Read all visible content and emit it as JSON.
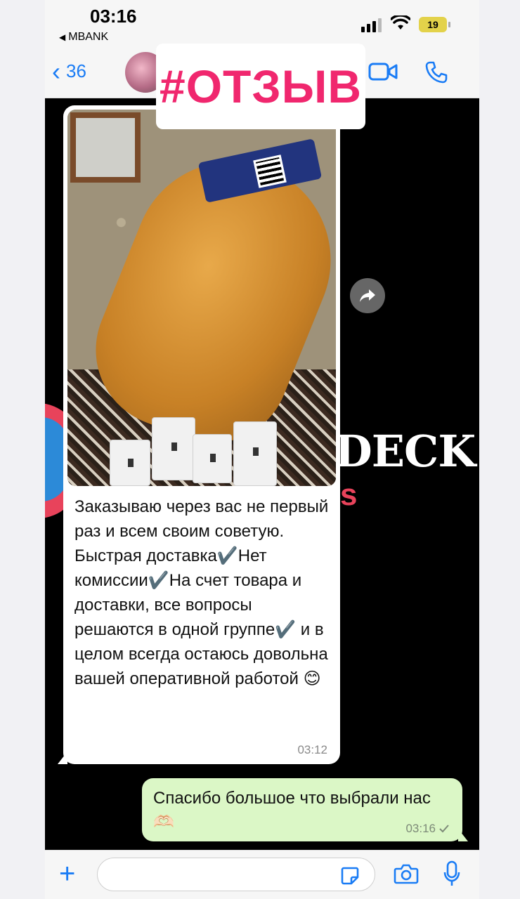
{
  "status_bar": {
    "time": "03:16",
    "carrier": "MBANK",
    "battery": "19"
  },
  "header": {
    "back_count": "36",
    "contact_avatar": "avatar",
    "icons": [
      "back-chevron-icon",
      "video-call-icon",
      "phone-call-icon"
    ]
  },
  "sticker": {
    "text": "#ОТЗЫВ"
  },
  "background_brand": {
    "deck": "DECK",
    "s": "s"
  },
  "messages": [
    {
      "direction": "incoming",
      "has_photo": true,
      "text": "Заказываю через вас не первый раз и всем своим советую. Быстрая доставка✔️Нет комиссии✔️На счет товара и доставки, все вопросы решаются в одной группе✔️ и в целом всегда остаюсь довольна вашей оперативной работой 😊",
      "time": "03:12"
    },
    {
      "direction": "outgoing",
      "text": "Спасибо большое  что выбрали нас 🫶🏻",
      "time": "03:16"
    }
  ],
  "input_bar": {
    "placeholder": "",
    "icons": [
      "plus-icon",
      "sticker-icon",
      "camera-icon",
      "microphone-icon"
    ]
  },
  "colors": {
    "accent": "#1a7cf5",
    "sticker_text": "#f0276e",
    "outgoing_bubble": "#dbf7c6",
    "incoming_bubble": "#ffffff",
    "chat_background": "#000000"
  }
}
